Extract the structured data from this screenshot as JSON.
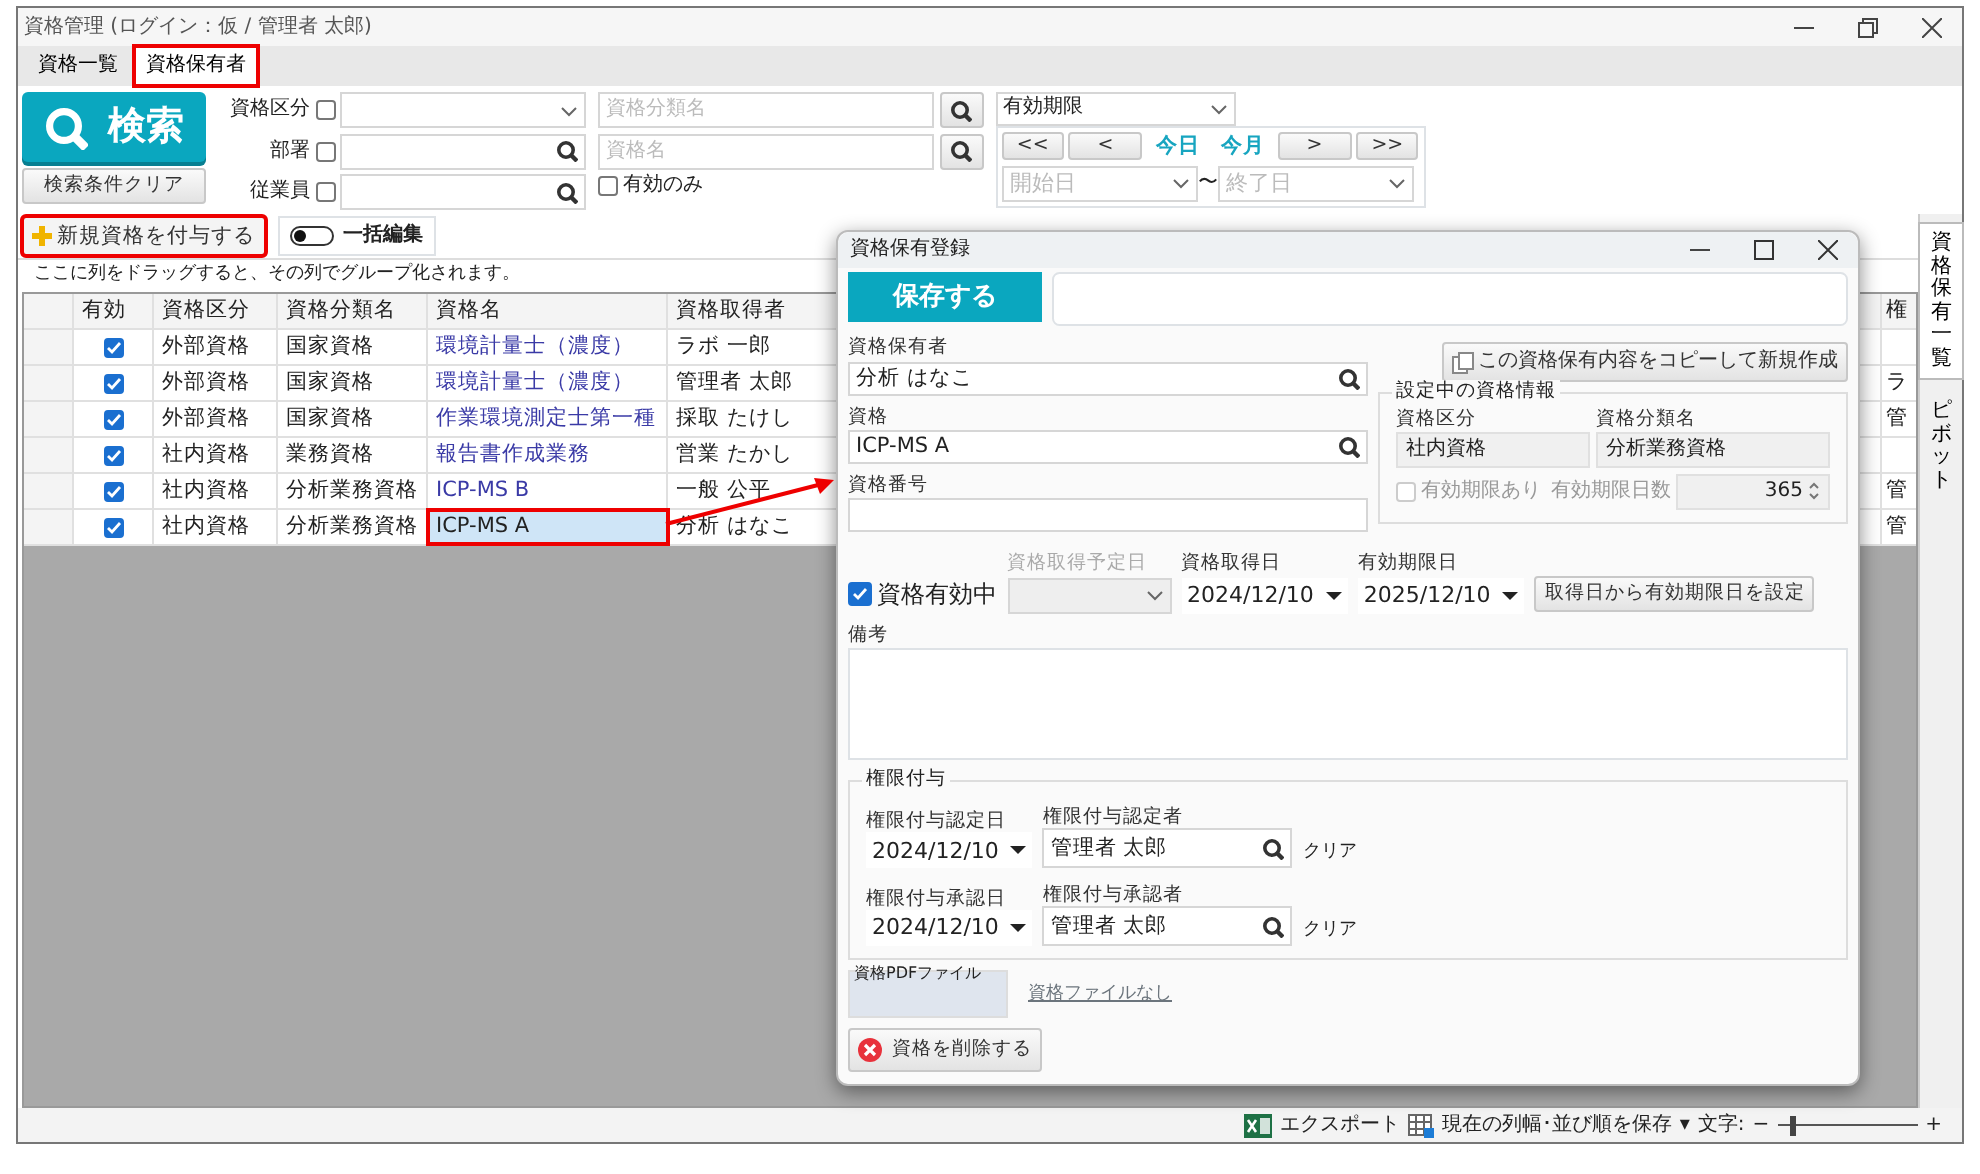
{
  "window": {
    "title": "資格管理 (ログイン：仮 / 管理者 太郎)"
  },
  "tabs": [
    {
      "label": "資格一覧",
      "selected": false,
      "highlighted": false
    },
    {
      "label": "資格保有者",
      "selected": true,
      "highlighted": true
    }
  ],
  "search": {
    "button": "検索",
    "clear_button": "検索条件クリア",
    "filters": [
      {
        "label": "資格区分",
        "checked": false,
        "kind": "dropdown"
      },
      {
        "label": "部署",
        "checked": false,
        "kind": "lookup"
      },
      {
        "label": "従業員",
        "checked": false,
        "kind": "lookup"
      }
    ],
    "name_fields": [
      {
        "placeholder": "資格分類名"
      },
      {
        "placeholder": "資格名"
      }
    ],
    "valid_only": {
      "label": "有効のみ",
      "checked": false
    },
    "period": {
      "value": "有効期限",
      "nav": [
        {
          "label": "<<",
          "kind": "button"
        },
        {
          "label": "<",
          "kind": "button"
        },
        {
          "label": "今日",
          "kind": "link"
        },
        {
          "label": "今月",
          "kind": "link"
        },
        {
          "label": ">",
          "kind": "button"
        },
        {
          "label": ">>",
          "kind": "button"
        }
      ],
      "start_placeholder": "開始日",
      "separator": "〜",
      "end_placeholder": "終了日"
    }
  },
  "toolbar": {
    "add_button": {
      "label": "新規資格を付与する",
      "highlighted": true
    },
    "bulk_edit": {
      "label": "一括編集",
      "on": false
    }
  },
  "group_hint": "ここに列をドラッグすると、その列でグループ化されます。",
  "table": {
    "columns": [
      "有効",
      "資格区分",
      "資格分類名",
      "資格名",
      "資格取得者",
      "権"
    ],
    "rows": [
      {
        "checked": true,
        "category": "外部資格",
        "classification": "国家資格",
        "name": "環境計量士（濃度）",
        "holder": "ラボ 一郎",
        "selected": false,
        "highlighted": false
      },
      {
        "checked": true,
        "category": "外部資格",
        "classification": "国家資格",
        "name": "環境計量士（濃度）",
        "holder": "管理者 太郎",
        "column_6": "ラ",
        "selected": false,
        "highlighted": false
      },
      {
        "checked": true,
        "category": "外部資格",
        "classification": "国家資格",
        "name": "作業環境測定士第一種",
        "holder": "採取 たけし",
        "column_6": "管",
        "selected": false,
        "highlighted": false
      },
      {
        "checked": true,
        "category": "社内資格",
        "classification": "業務資格",
        "name": "報告書作成業務",
        "holder": "営業 たかし",
        "selected": false,
        "highlighted": false
      },
      {
        "checked": true,
        "category": "社内資格",
        "classification": "分析業務資格",
        "name": "ICP-MS B",
        "holder": "一般 公平",
        "column_6": "管",
        "selected": false,
        "highlighted": false
      },
      {
        "checked": true,
        "category": "社内資格",
        "classification": "分析業務資格",
        "name": "ICP-MS A",
        "holder": "分析 はなこ",
        "column_6": "管",
        "selected": true,
        "highlighted": true
      }
    ]
  },
  "side_tabs": [
    {
      "label": "資格保有一覧",
      "selected": true
    },
    {
      "label": "ピボット",
      "selected": false
    }
  ],
  "status_bar": {
    "export": "エクスポート",
    "save_layout": "現在の列幅･並び順を保存",
    "menu": "▾",
    "font_label": "文字:",
    "minus": "−",
    "plus": "+",
    "font_size": {
      "level": 0.1
    }
  },
  "dialog": {
    "title": "資格保有登録",
    "save_button": "保存する",
    "holder": {
      "label": "資格保有者",
      "value": "分析 はなこ"
    },
    "qualification": {
      "label": "資格",
      "value": "ICP-MS A"
    },
    "number": {
      "label": "資格番号"
    },
    "copy_button": "この資格保有内容をコピーして新規作成",
    "info": {
      "legend": "設定中の資格情報",
      "category_label": "資格区分",
      "category": "社内資格",
      "class_label": "資格分類名",
      "class": "分析業務資格",
      "has_expiry": {
        "label": "有効期限あり",
        "checked": false,
        "disabled": true
      },
      "days_label": "有効期限日数",
      "days": "365"
    },
    "active": {
      "label": "資格有効中",
      "checked": true
    },
    "planned_date": {
      "label": "資格取得予定日",
      "disabled": true
    },
    "acquired_date": {
      "label": "資格取得日",
      "value": "2024/12/10"
    },
    "expiry_date": {
      "label": "有効期限日",
      "value": "2025/12/10"
    },
    "set_expiry_button": "取得日から有効期限日を設定",
    "notes": {
      "label": "備考"
    },
    "authority": {
      "legend": "権限付与",
      "rows": [
        {
          "date_label": "権限付与認定日",
          "date": "2024/12/10",
          "person_label": "権限付与認定者",
          "person": "管理者 太郎",
          "clear": "クリア"
        },
        {
          "date_label": "権限付与承認日",
          "date": "2024/12/10",
          "person_label": "権限付与承認者",
          "person": "管理者 太郎",
          "clear": "クリア"
        }
      ]
    },
    "pdf": {
      "label": "資格PDFファイル",
      "link": "資格ファイルなし"
    },
    "delete_button": "資格を削除する"
  }
}
